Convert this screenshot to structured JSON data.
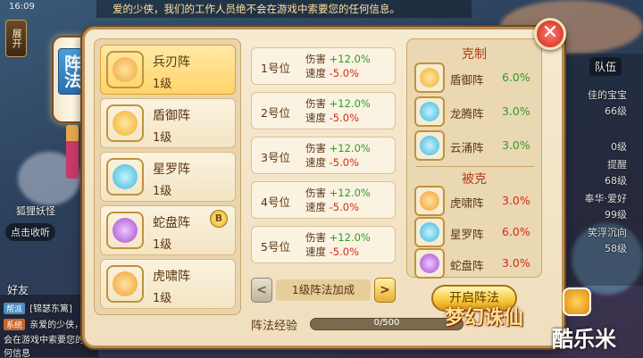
{
  "status": {
    "time": "16:09"
  },
  "notice": "爱的少侠，我们的工作人员绝不会在游戏中索要您的任何信息。",
  "side_button": "展开",
  "panel_title": "阵法",
  "background": {
    "pet_name": "狐狸妖怪",
    "call_button": "点击收听",
    "friends": "好友",
    "chat_tags": [
      "帮派",
      "系统"
    ],
    "chat_lines": [
      "[锦瑟东篱]",
      "亲爱的少侠，",
      "会在游戏中索要您的任何信息"
    ],
    "right_tab": "队伍",
    "right_lines": [
      "佳的宝宝",
      "66级",
      "0级",
      "提醒",
      "68级",
      "奉华·爱好",
      "99级",
      "笑浮沉向",
      "58级"
    ]
  },
  "formations": [
    {
      "name": "兵刃阵",
      "level": "1级",
      "icon": "blade-formation-icon",
      "color": "#f2a23a",
      "active": true
    },
    {
      "name": "盾御阵",
      "level": "1级",
      "icon": "shield-formation-icon",
      "color": "#f0b030"
    },
    {
      "name": "星罗阵",
      "level": "1级",
      "icon": "star-formation-icon",
      "color": "#38b7d8"
    },
    {
      "name": "蛇盘阵",
      "level": "1级",
      "icon": "snake-formation-icon",
      "color": "#a24ad0",
      "badge": "B"
    },
    {
      "name": "虎啸阵",
      "level": "1级",
      "icon": "tiger-formation-icon",
      "color": "#f0a030"
    }
  ],
  "slots": [
    {
      "position": "1号位",
      "attack_label": "伤害",
      "attack_value": "+12.0%",
      "speed_label": "速度",
      "speed_value": "-5.0%"
    },
    {
      "position": "2号位",
      "attack_label": "伤害",
      "attack_value": "+12.0%",
      "speed_label": "速度",
      "speed_value": "-5.0%"
    },
    {
      "position": "3号位",
      "attack_label": "伤害",
      "attack_value": "+12.0%",
      "speed_label": "速度",
      "speed_value": "-5.0%"
    },
    {
      "position": "4号位",
      "attack_label": "伤害",
      "attack_value": "+12.0%",
      "speed_label": "速度",
      "speed_value": "-5.0%"
    },
    {
      "position": "5号位",
      "attack_label": "伤害",
      "attack_value": "+12.0%",
      "speed_label": "速度",
      "speed_value": "-5.0%"
    }
  ],
  "bonus": {
    "label": "1级阵法加成",
    "prev": "<",
    "next": ">"
  },
  "experience": {
    "label": "阵法经验",
    "text": "0/500",
    "fraction": 0.0
  },
  "counters": {
    "title": "克制",
    "items": [
      {
        "name": "盾御阵",
        "value": "6.0%",
        "color": "#f0b030"
      },
      {
        "name": "龙腾阵",
        "value": "3.0%",
        "color": "#38b7d8"
      },
      {
        "name": "云涌阵",
        "value": "3.0%",
        "color": "#38b7d8"
      }
    ]
  },
  "countered_by": {
    "title": "被克",
    "items": [
      {
        "name": "虎啸阵",
        "value": "3.0%",
        "color": "#f0a030"
      },
      {
        "name": "星罗阵",
        "value": "6.0%",
        "color": "#38b7d8"
      },
      {
        "name": "蛇盘阵",
        "value": "3.0%",
        "color": "#a24ad0"
      }
    ]
  },
  "open_button": "开启阵法",
  "close_button": "✕",
  "logos": {
    "game": "梦幻诛仙",
    "site": "酷乐米"
  }
}
